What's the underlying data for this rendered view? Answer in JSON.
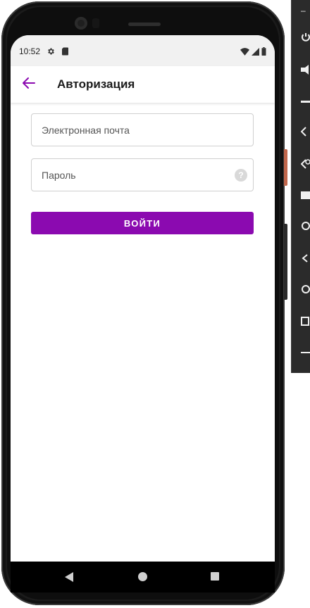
{
  "status_bar": {
    "time": "10:52",
    "icons": [
      "settings-gear-icon",
      "sd-card-icon"
    ],
    "right_icons": [
      "wifi-icon",
      "signal-icon",
      "battery-icon"
    ]
  },
  "app_bar": {
    "title": "Авторизация",
    "back_icon": "arrow-left-icon",
    "accent_color": "#8b0ab0"
  },
  "form": {
    "email": {
      "placeholder": "Электронная почта",
      "value": ""
    },
    "password": {
      "placeholder": "Пароль",
      "value": "",
      "help_glyph": "?"
    },
    "submit_label": "ВОЙТИ",
    "button_color": "#8b0ab0"
  },
  "nav_bar": {
    "buttons": [
      "back-triangle-icon",
      "home-circle-icon",
      "recents-square-icon"
    ]
  },
  "emulator_toolbar": {
    "minimize_glyph": "–",
    "items": [
      "power-icon",
      "volume-up-icon",
      "volume-down-icon",
      "rotate-left-icon",
      "rotate-right-icon",
      "screenshot-icon",
      "zoom-icon",
      "back-icon",
      "home-icon",
      "overview-icon",
      "more-icon"
    ]
  }
}
